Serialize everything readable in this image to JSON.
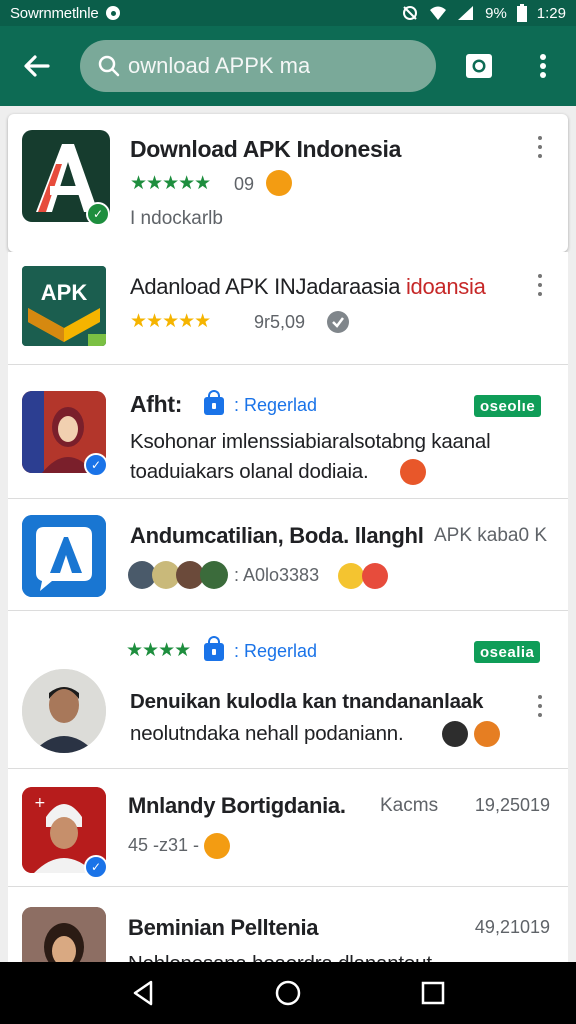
{
  "status_bar": {
    "carrier": "Sowrnmetlnle",
    "battery": "9%",
    "time": "1:29"
  },
  "app_bar": {
    "search_query": "ownload APPK ma",
    "icons": [
      "back-arrow-icon",
      "search-icon",
      "camera-icon",
      "more-vert-icon"
    ]
  },
  "results": [
    {
      "title": "Download APK Indonesia",
      "rating_text": "★★★★★",
      "rating_value": "09",
      "developer": "I ndockarlb",
      "accent": "#c0392b"
    },
    {
      "title": "Adanload APK INJadaraasia ",
      "title_red": "idoansia",
      "stars": "★★★★★",
      "rating_value": "9r5,09"
    },
    {
      "title": "Afht:",
      "link": ": Regerlad",
      "badge": "oseolıe",
      "text_line1": "Ksohonar imlenssiabiaralsotabng kaanal",
      "text_line2": "toaduiakars olanal dodiaia."
    },
    {
      "title": "Andumcatilian, Boda. llanghl",
      "title_suffix": "APK kaba0 K",
      "meta": ": A0lo3383"
    },
    {
      "stars": "★★★★",
      "link": ": Regerlad",
      "badge": "osealia",
      "text_line1": "Denuikan kulodla kan tnandananlaak",
      "text_line2": "neolutndaka nehall podaniann."
    },
    {
      "title": "Mnlandy Bortigdania.",
      "title_suffix": "Kacms",
      "number": "19,25019",
      "meta": "45 -z31 -"
    },
    {
      "title": "Beminian Pelltenia",
      "number": "49,21019",
      "text_line1": "Nehlonesana boaordra dlanantout"
    }
  ],
  "colors": {
    "app_bar": "#0d6b54",
    "status_bar": "#0b5e4a",
    "badge_green": "#0f9d58",
    "link_blue": "#1a73e8",
    "star_green": "#1e8e3e",
    "star_gold": "#f5b400"
  }
}
